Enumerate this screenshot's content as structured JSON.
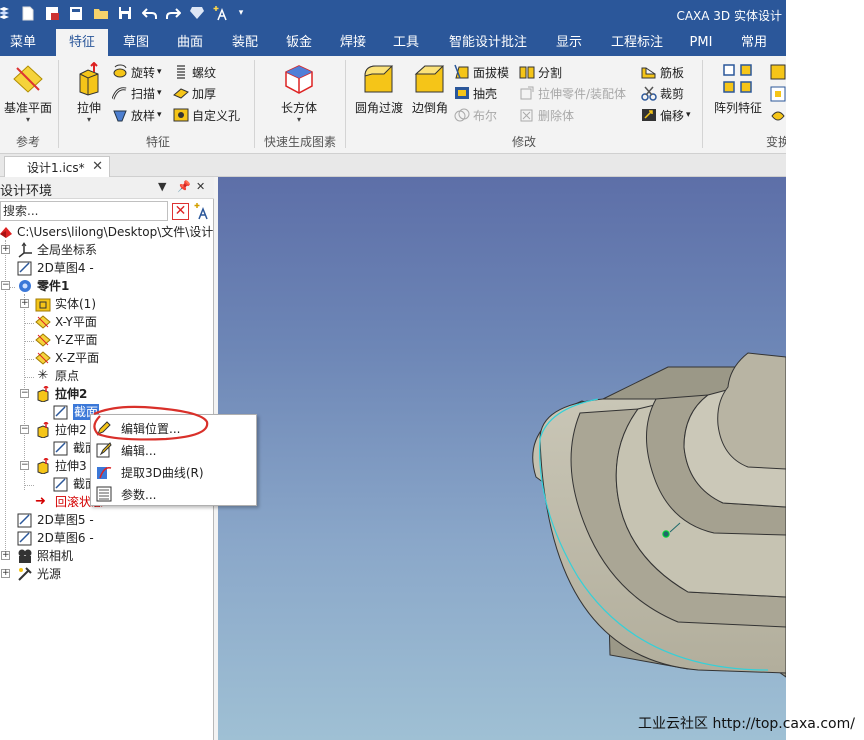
{
  "app": {
    "title": "CAXA 3D 实体设计"
  },
  "quick_access": [
    "app-logo-icon",
    "new-icon",
    "open-icon",
    "save-as-icon",
    "folder-icon",
    "save-icon",
    "undo-icon",
    "redo-icon",
    "gem-icon",
    "sparkle-icon",
    "dropdown-icon"
  ],
  "tabs": [
    {
      "label": "菜单"
    },
    {
      "label": "特征",
      "active": true
    },
    {
      "label": "草图"
    },
    {
      "label": "曲面"
    },
    {
      "label": "装配"
    },
    {
      "label": "钣金"
    },
    {
      "label": "焊接"
    },
    {
      "label": "工具"
    },
    {
      "label": "智能设计批注"
    },
    {
      "label": "显示"
    },
    {
      "label": "工程标注"
    },
    {
      "label": "PMI"
    },
    {
      "label": "常用"
    }
  ],
  "ribbon": {
    "groups": {
      "ref": "参考",
      "feature": "特征",
      "quick": "快速生成图素",
      "modify": "修改",
      "transform": "变换"
    },
    "base_plane": "基准平面",
    "extrude": "拉伸",
    "revolve": "旋转",
    "sweep": "扫描",
    "loft": "放样",
    "thread": "螺纹",
    "thicken": "加厚",
    "custom_hole": "自定义孔",
    "box": "长方体",
    "fillet": "圆角过渡",
    "chamfer": "边倒角",
    "draft": "面拔模",
    "shell": "抽壳",
    "boolean": "布尔",
    "split": "分割",
    "extrude_part": "拉伸零件/装配体",
    "delete_body": "删除体",
    "rib": "筋板",
    "trim": "裁剪",
    "offset": "偏移",
    "pattern": "阵列特征"
  },
  "doc_tab": {
    "label": "设计1.ics*"
  },
  "panel": {
    "title": "设计环境",
    "search_placeholder": "搜索..."
  },
  "tree": [
    {
      "label": "C:\\Users\\lilong\\Desktop\\文件\\设计",
      "icon": "design-root-icon"
    },
    {
      "label": "全局坐标系",
      "icon": "axes-icon"
    },
    {
      "label": "2D草图4 -",
      "icon": "sketch-icon"
    },
    {
      "label": "零件1",
      "icon": "part-icon"
    },
    {
      "label": "实体(1)",
      "icon": "solid-folder-icon"
    },
    {
      "label": "X-Y平面",
      "icon": "plane-icon"
    },
    {
      "label": "Y-Z平面",
      "icon": "plane-icon"
    },
    {
      "label": "X-Z平面",
      "icon": "plane-icon"
    },
    {
      "label": "原点",
      "icon": "origin-icon"
    },
    {
      "label": "拉伸2",
      "icon": "extrude-icon"
    },
    {
      "label": "截面",
      "icon": "sketch-icon"
    },
    {
      "label": "拉伸2",
      "icon": "extrude-icon"
    },
    {
      "label": "截面",
      "icon": "sketch-icon"
    },
    {
      "label": "拉伸3",
      "icon": "extrude-icon"
    },
    {
      "label": "截面",
      "icon": "sketch-icon"
    },
    {
      "label": "回滚状态",
      "icon": "rollback-arrow-icon"
    },
    {
      "label": "2D草图5 -",
      "icon": "sketch-icon"
    },
    {
      "label": "2D草图6 -",
      "icon": "sketch-icon"
    },
    {
      "label": "照相机",
      "icon": "camera-icon"
    },
    {
      "label": "光源",
      "icon": "light-icon"
    }
  ],
  "context_menu": [
    {
      "label": "编辑位置...",
      "icon": "edit-position-icon"
    },
    {
      "label": "编辑...",
      "icon": "edit-icon"
    },
    {
      "label": "提取3D曲线(R)",
      "icon": "extract-curve-icon"
    },
    {
      "label": "参数...",
      "icon": "parameters-icon"
    }
  ],
  "colors": {
    "accent": "#2b579a",
    "annotation": "#d9302a",
    "selection": "#3b78d8"
  },
  "watermark": "工业云社区 http://top.caxa.com/"
}
